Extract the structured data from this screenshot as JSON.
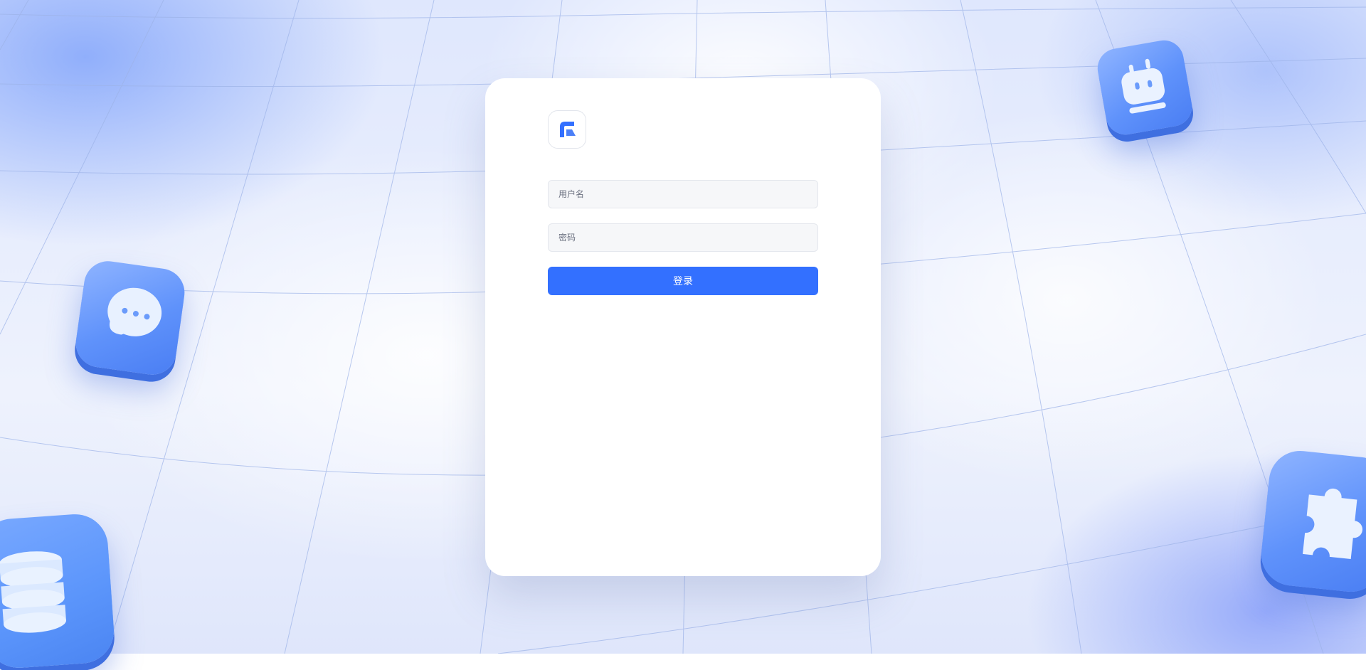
{
  "login_form": {
    "username_placeholder": "用户名",
    "password_placeholder": "密码",
    "submit_label": "登录"
  },
  "icons": {
    "logo": "app-logo-icon",
    "decor_top_right": "robot-icon",
    "decor_left": "chat-bubble-icon",
    "decor_bottom_left": "database-icon",
    "decor_bottom_right": "puzzle-icon"
  },
  "colors": {
    "accent": "#3370ff",
    "card_background": "#ffffff",
    "input_background": "#f6f7f9",
    "page_background": "#e8eefc"
  }
}
